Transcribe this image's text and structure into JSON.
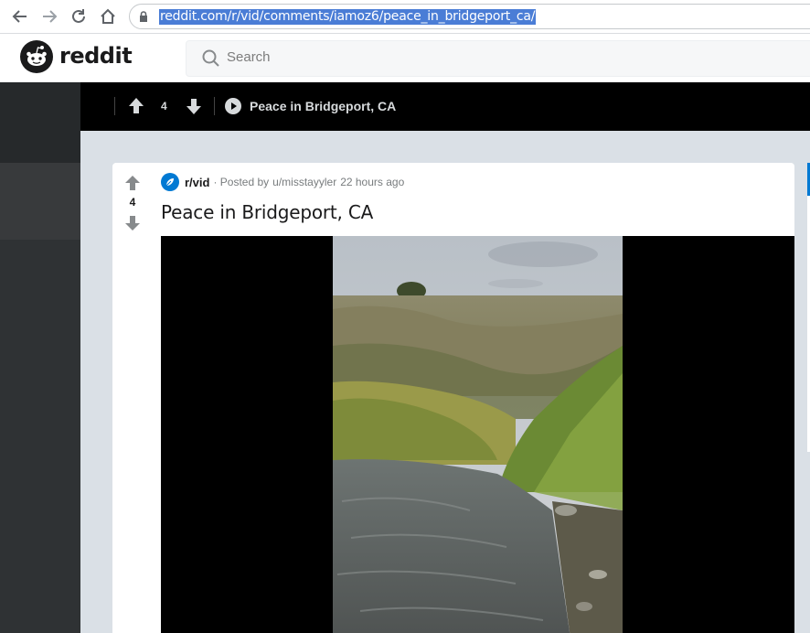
{
  "browser": {
    "url": "reddit.com/r/vid/comments/iamoz6/peace_in_bridgeport_ca/"
  },
  "header": {
    "brand": "reddit",
    "search_placeholder": "Search"
  },
  "post_bar": {
    "score": "4",
    "title": "Peace in Bridgeport, CA"
  },
  "post": {
    "score": "4",
    "subreddit": "r/vid",
    "posted_by_prefix": "· Posted by",
    "author": "u/misstayyler",
    "time": "22 hours ago",
    "title": "Peace in Bridgeport, CA"
  },
  "colors": {
    "accent": "#0079d3",
    "url_highlight": "#4a7dd6",
    "post_bar_bg": "#000000",
    "content_bg": "#dae0e6"
  },
  "icons": {
    "back": "arrow-left-icon",
    "forward": "arrow-right-icon",
    "reload": "reload-icon",
    "home": "home-icon",
    "lock": "lock-icon",
    "search": "search-icon",
    "upvote": "arrow-up-icon",
    "downvote": "arrow-down-icon",
    "play": "play-icon"
  }
}
